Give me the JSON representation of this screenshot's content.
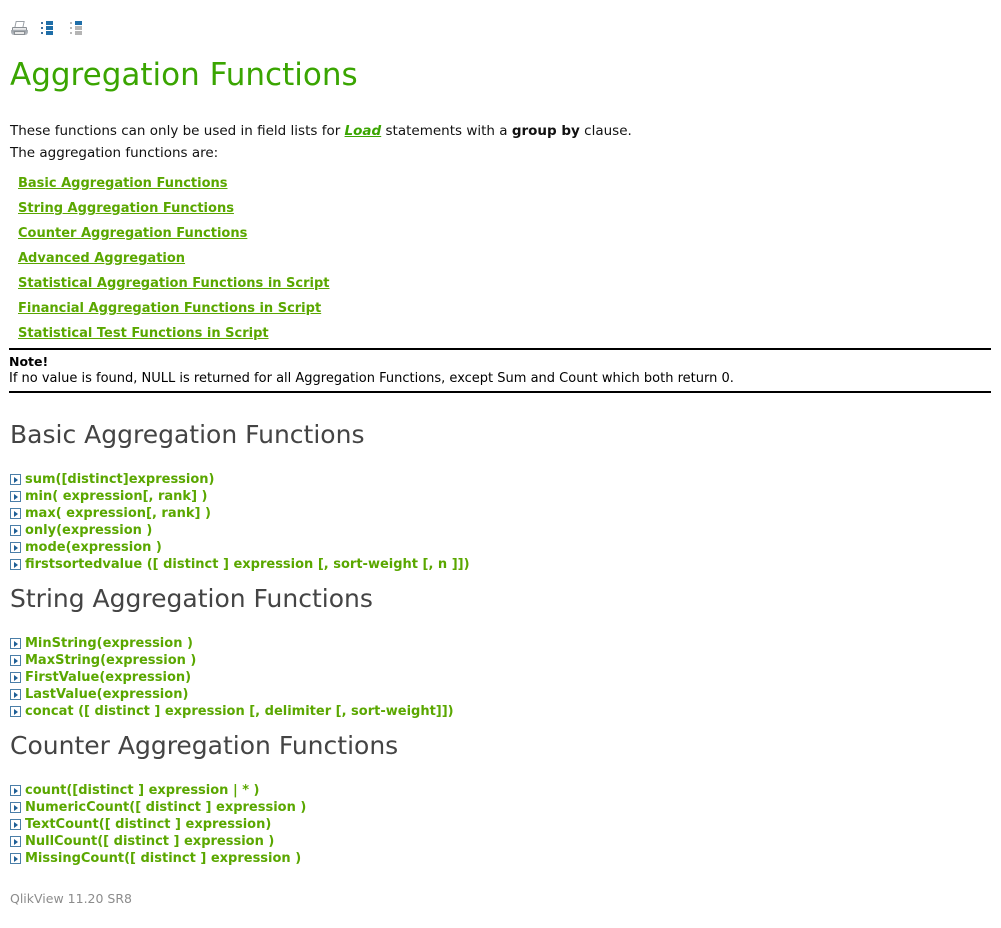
{
  "toolbar": {
    "icons": [
      {
        "name": "print-icon",
        "label": "Print"
      },
      {
        "name": "expand-all-icon",
        "label": "Expand All"
      },
      {
        "name": "collapse-all-icon",
        "label": "Collapse All"
      }
    ]
  },
  "page_title": "Aggregation Functions",
  "intro": {
    "line1_part1": "These functions can only be used in field lists for ",
    "line1_link": "Load",
    "line1_part2": " statements with a ",
    "line1_bold": "group by",
    "line1_part3": " clause.",
    "line2": "The aggregation functions are:"
  },
  "toc": {
    "links": [
      "Basic Aggregation Functions",
      "String Aggregation Functions",
      "Counter Aggregation Functions",
      "Advanced Aggregation",
      "Statistical Aggregation Functions in Script",
      "Financial Aggregation Functions in Script",
      "Statistical Test Functions in Script"
    ]
  },
  "note": {
    "title": "Note!",
    "body": "If no value is found, NULL is returned for all Aggregation Functions, except Sum and Count which both return 0."
  },
  "sections": [
    {
      "heading": "Basic Aggregation Functions",
      "functions": [
        "sum([distinct]expression)",
        "min( expression[, rank] )",
        "max( expression[, rank] )",
        "only(expression )",
        "mode(expression )",
        "firstsortedvalue ([ distinct ] expression [, sort-weight [, n ]])"
      ]
    },
    {
      "heading": "String Aggregation Functions",
      "functions": [
        "MinString(expression )",
        "MaxString(expression )",
        "FirstValue(expression)",
        "LastValue(expression)",
        "concat ([ distinct ] expression [, delimiter [, sort-weight]])"
      ]
    },
    {
      "heading": "Counter Aggregation Functions",
      "functions": [
        "count([distinct ] expression | * )",
        "NumericCount([ distinct ] expression )",
        "TextCount([ distinct ] expression)",
        "NullCount([ distinct ] expression )",
        "MissingCount([ distinct ] expression )"
      ]
    }
  ],
  "footer": "QlikView 11.20 SR8",
  "colors": {
    "title_green": "#3aa501",
    "link_green": "#5aa700",
    "heading_gray": "#444444",
    "footer_gray": "#8c8c8c",
    "expander_blue": "#1f5f96"
  }
}
